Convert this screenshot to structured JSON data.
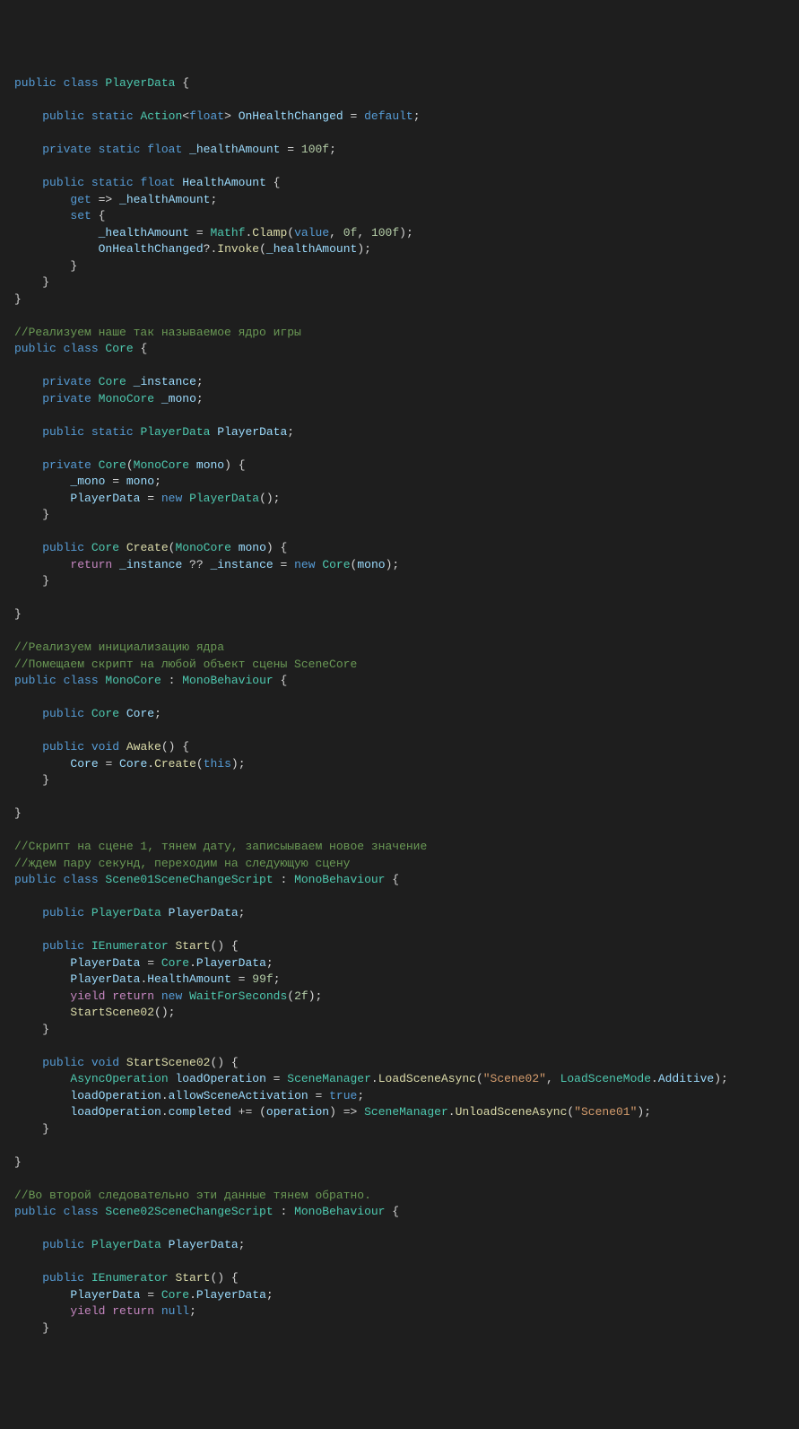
{
  "lines": [
    [
      {
        "t": "public ",
        "c": "kw"
      },
      {
        "t": "class ",
        "c": "kw"
      },
      {
        "t": "PlayerData",
        "c": "type"
      },
      {
        "t": " {",
        "c": "punc"
      }
    ],
    [],
    [
      {
        "t": "    ",
        "c": "punc"
      },
      {
        "t": "public ",
        "c": "kw"
      },
      {
        "t": "static ",
        "c": "kw"
      },
      {
        "t": "Action",
        "c": "type"
      },
      {
        "t": "<",
        "c": "punc"
      },
      {
        "t": "float",
        "c": "kw"
      },
      {
        "t": "> ",
        "c": "punc"
      },
      {
        "t": "OnHealthChanged",
        "c": "var"
      },
      {
        "t": " = ",
        "c": "punc"
      },
      {
        "t": "default",
        "c": "kw"
      },
      {
        "t": ";",
        "c": "punc"
      }
    ],
    [],
    [
      {
        "t": "    ",
        "c": "punc"
      },
      {
        "t": "private ",
        "c": "kw"
      },
      {
        "t": "static ",
        "c": "kw"
      },
      {
        "t": "float ",
        "c": "kw"
      },
      {
        "t": "_healthAmount",
        "c": "var"
      },
      {
        "t": " = ",
        "c": "punc"
      },
      {
        "t": "100f",
        "c": "num"
      },
      {
        "t": ";",
        "c": "punc"
      }
    ],
    [],
    [
      {
        "t": "    ",
        "c": "punc"
      },
      {
        "t": "public ",
        "c": "kw"
      },
      {
        "t": "static ",
        "c": "kw"
      },
      {
        "t": "float ",
        "c": "kw"
      },
      {
        "t": "HealthAmount",
        "c": "var"
      },
      {
        "t": " {",
        "c": "punc"
      }
    ],
    [
      {
        "t": "        ",
        "c": "punc"
      },
      {
        "t": "get",
        "c": "kw"
      },
      {
        "t": " => ",
        "c": "punc"
      },
      {
        "t": "_healthAmount",
        "c": "var"
      },
      {
        "t": ";",
        "c": "punc"
      }
    ],
    [
      {
        "t": "        ",
        "c": "punc"
      },
      {
        "t": "set",
        "c": "kw"
      },
      {
        "t": " {",
        "c": "punc"
      }
    ],
    [
      {
        "t": "            ",
        "c": "punc"
      },
      {
        "t": "_healthAmount",
        "c": "var"
      },
      {
        "t": " = ",
        "c": "punc"
      },
      {
        "t": "Mathf",
        "c": "type"
      },
      {
        "t": ".",
        "c": "punc"
      },
      {
        "t": "Clamp",
        "c": "method"
      },
      {
        "t": "(",
        "c": "punc"
      },
      {
        "t": "value",
        "c": "kw"
      },
      {
        "t": ", ",
        "c": "punc"
      },
      {
        "t": "0f",
        "c": "num"
      },
      {
        "t": ", ",
        "c": "punc"
      },
      {
        "t": "100f",
        "c": "num"
      },
      {
        "t": ");",
        "c": "punc"
      }
    ],
    [
      {
        "t": "            ",
        "c": "punc"
      },
      {
        "t": "OnHealthChanged",
        "c": "var"
      },
      {
        "t": "?.",
        "c": "punc"
      },
      {
        "t": "Invoke",
        "c": "method"
      },
      {
        "t": "(",
        "c": "punc"
      },
      {
        "t": "_healthAmount",
        "c": "var"
      },
      {
        "t": ");",
        "c": "punc"
      }
    ],
    [
      {
        "t": "        }",
        "c": "punc"
      }
    ],
    [
      {
        "t": "    }",
        "c": "punc"
      }
    ],
    [
      {
        "t": "}",
        "c": "punc"
      }
    ],
    [],
    [
      {
        "t": "//Реализуем наше так называемое ядро игры",
        "c": "comment"
      }
    ],
    [
      {
        "t": "public ",
        "c": "kw"
      },
      {
        "t": "class ",
        "c": "kw"
      },
      {
        "t": "Core",
        "c": "type"
      },
      {
        "t": " {",
        "c": "punc"
      }
    ],
    [],
    [
      {
        "t": "    ",
        "c": "punc"
      },
      {
        "t": "private ",
        "c": "kw"
      },
      {
        "t": "Core ",
        "c": "type"
      },
      {
        "t": "_instance",
        "c": "var"
      },
      {
        "t": ";",
        "c": "punc"
      }
    ],
    [
      {
        "t": "    ",
        "c": "punc"
      },
      {
        "t": "private ",
        "c": "kw"
      },
      {
        "t": "MonoCore ",
        "c": "type"
      },
      {
        "t": "_mono",
        "c": "var"
      },
      {
        "t": ";",
        "c": "punc"
      }
    ],
    [],
    [
      {
        "t": "    ",
        "c": "punc"
      },
      {
        "t": "public ",
        "c": "kw"
      },
      {
        "t": "static ",
        "c": "kw"
      },
      {
        "t": "PlayerData ",
        "c": "type"
      },
      {
        "t": "PlayerData",
        "c": "var"
      },
      {
        "t": ";",
        "c": "punc"
      }
    ],
    [],
    [
      {
        "t": "    ",
        "c": "punc"
      },
      {
        "t": "private ",
        "c": "kw"
      },
      {
        "t": "Core",
        "c": "type"
      },
      {
        "t": "(",
        "c": "punc"
      },
      {
        "t": "MonoCore ",
        "c": "type"
      },
      {
        "t": "mono",
        "c": "var"
      },
      {
        "t": ") {",
        "c": "punc"
      }
    ],
    [
      {
        "t": "        ",
        "c": "punc"
      },
      {
        "t": "_mono",
        "c": "var"
      },
      {
        "t": " = ",
        "c": "punc"
      },
      {
        "t": "mono",
        "c": "var"
      },
      {
        "t": ";",
        "c": "punc"
      }
    ],
    [
      {
        "t": "        ",
        "c": "punc"
      },
      {
        "t": "PlayerData",
        "c": "var"
      },
      {
        "t": " = ",
        "c": "punc"
      },
      {
        "t": "new ",
        "c": "kw"
      },
      {
        "t": "PlayerData",
        "c": "type"
      },
      {
        "t": "();",
        "c": "punc"
      }
    ],
    [
      {
        "t": "    }",
        "c": "punc"
      }
    ],
    [],
    [
      {
        "t": "    ",
        "c": "punc"
      },
      {
        "t": "public ",
        "c": "kw"
      },
      {
        "t": "Core ",
        "c": "type"
      },
      {
        "t": "Create",
        "c": "method"
      },
      {
        "t": "(",
        "c": "punc"
      },
      {
        "t": "MonoCore ",
        "c": "type"
      },
      {
        "t": "mono",
        "c": "var"
      },
      {
        "t": ") {",
        "c": "punc"
      }
    ],
    [
      {
        "t": "        ",
        "c": "punc"
      },
      {
        "t": "return ",
        "c": "ctrl"
      },
      {
        "t": "_instance",
        "c": "var"
      },
      {
        "t": " ?? ",
        "c": "punc"
      },
      {
        "t": "_instance",
        "c": "var"
      },
      {
        "t": " = ",
        "c": "punc"
      },
      {
        "t": "new ",
        "c": "kw"
      },
      {
        "t": "Core",
        "c": "type"
      },
      {
        "t": "(",
        "c": "punc"
      },
      {
        "t": "mono",
        "c": "var"
      },
      {
        "t": ");",
        "c": "punc"
      }
    ],
    [
      {
        "t": "    }",
        "c": "punc"
      }
    ],
    [],
    [
      {
        "t": "}",
        "c": "punc"
      }
    ],
    [],
    [
      {
        "t": "//Реализуем инициализацию ядра",
        "c": "comment"
      }
    ],
    [
      {
        "t": "//Помещаем скрипт на любой объект сцены SceneCore",
        "c": "comment"
      }
    ],
    [
      {
        "t": "public ",
        "c": "kw"
      },
      {
        "t": "class ",
        "c": "kw"
      },
      {
        "t": "MonoCore",
        "c": "type"
      },
      {
        "t": " : ",
        "c": "punc"
      },
      {
        "t": "MonoBehaviour",
        "c": "type"
      },
      {
        "t": " {",
        "c": "punc"
      }
    ],
    [],
    [
      {
        "t": "    ",
        "c": "punc"
      },
      {
        "t": "public ",
        "c": "kw"
      },
      {
        "t": "Core ",
        "c": "type"
      },
      {
        "t": "Core",
        "c": "var"
      },
      {
        "t": ";",
        "c": "punc"
      }
    ],
    [],
    [
      {
        "t": "    ",
        "c": "punc"
      },
      {
        "t": "public ",
        "c": "kw"
      },
      {
        "t": "void ",
        "c": "kw"
      },
      {
        "t": "Awake",
        "c": "method"
      },
      {
        "t": "() {",
        "c": "punc"
      }
    ],
    [
      {
        "t": "        ",
        "c": "punc"
      },
      {
        "t": "Core",
        "c": "var"
      },
      {
        "t": " = ",
        "c": "punc"
      },
      {
        "t": "Core",
        "c": "var"
      },
      {
        "t": ".",
        "c": "punc"
      },
      {
        "t": "Create",
        "c": "method"
      },
      {
        "t": "(",
        "c": "punc"
      },
      {
        "t": "this",
        "c": "kw"
      },
      {
        "t": ");",
        "c": "punc"
      }
    ],
    [
      {
        "t": "    }",
        "c": "punc"
      }
    ],
    [],
    [
      {
        "t": "}",
        "c": "punc"
      }
    ],
    [],
    [
      {
        "t": "//Скрипт на сцене 1, тянем дату, записыываем новое значение",
        "c": "comment"
      }
    ],
    [
      {
        "t": "//ждем пару секунд, переходим на следующую сцену",
        "c": "comment"
      }
    ],
    [
      {
        "t": "public ",
        "c": "kw"
      },
      {
        "t": "class ",
        "c": "kw"
      },
      {
        "t": "Scene01SceneChangeScript",
        "c": "type"
      },
      {
        "t": " : ",
        "c": "punc"
      },
      {
        "t": "MonoBehaviour",
        "c": "type"
      },
      {
        "t": " {",
        "c": "punc"
      }
    ],
    [],
    [
      {
        "t": "    ",
        "c": "punc"
      },
      {
        "t": "public ",
        "c": "kw"
      },
      {
        "t": "PlayerData ",
        "c": "type"
      },
      {
        "t": "PlayerData",
        "c": "var"
      },
      {
        "t": ";",
        "c": "punc"
      }
    ],
    [],
    [
      {
        "t": "    ",
        "c": "punc"
      },
      {
        "t": "public ",
        "c": "kw"
      },
      {
        "t": "IEnumerator ",
        "c": "type"
      },
      {
        "t": "Start",
        "c": "method"
      },
      {
        "t": "() {",
        "c": "punc"
      }
    ],
    [
      {
        "t": "        ",
        "c": "punc"
      },
      {
        "t": "PlayerData",
        "c": "var"
      },
      {
        "t": " = ",
        "c": "punc"
      },
      {
        "t": "Core",
        "c": "type"
      },
      {
        "t": ".",
        "c": "punc"
      },
      {
        "t": "PlayerData",
        "c": "var"
      },
      {
        "t": ";",
        "c": "punc"
      }
    ],
    [
      {
        "t": "        ",
        "c": "punc"
      },
      {
        "t": "PlayerData",
        "c": "var"
      },
      {
        "t": ".",
        "c": "punc"
      },
      {
        "t": "HealthAmount",
        "c": "var"
      },
      {
        "t": " = ",
        "c": "punc"
      },
      {
        "t": "99f",
        "c": "num"
      },
      {
        "t": ";",
        "c": "punc"
      }
    ],
    [
      {
        "t": "        ",
        "c": "punc"
      },
      {
        "t": "yield ",
        "c": "ctrl"
      },
      {
        "t": "return ",
        "c": "ctrl"
      },
      {
        "t": "new ",
        "c": "kw"
      },
      {
        "t": "WaitForSeconds",
        "c": "type"
      },
      {
        "t": "(",
        "c": "punc"
      },
      {
        "t": "2f",
        "c": "num"
      },
      {
        "t": ");",
        "c": "punc"
      }
    ],
    [
      {
        "t": "        ",
        "c": "punc"
      },
      {
        "t": "StartScene02",
        "c": "method"
      },
      {
        "t": "();",
        "c": "punc"
      }
    ],
    [
      {
        "t": "    }",
        "c": "punc"
      }
    ],
    [],
    [
      {
        "t": "    ",
        "c": "punc"
      },
      {
        "t": "public ",
        "c": "kw"
      },
      {
        "t": "void ",
        "c": "kw"
      },
      {
        "t": "StartScene02",
        "c": "method"
      },
      {
        "t": "() {",
        "c": "punc"
      }
    ],
    [
      {
        "t": "        ",
        "c": "punc"
      },
      {
        "t": "AsyncOperation ",
        "c": "type"
      },
      {
        "t": "loadOperation",
        "c": "var"
      },
      {
        "t": " = ",
        "c": "punc"
      },
      {
        "t": "SceneManager",
        "c": "type"
      },
      {
        "t": ".",
        "c": "punc"
      },
      {
        "t": "LoadSceneAsync",
        "c": "method"
      },
      {
        "t": "(",
        "c": "punc"
      },
      {
        "t": "\"Scene02\"",
        "c": "str"
      },
      {
        "t": ", ",
        "c": "punc"
      },
      {
        "t": "LoadSceneMode",
        "c": "type"
      },
      {
        "t": ".",
        "c": "punc"
      },
      {
        "t": "Additive",
        "c": "var"
      },
      {
        "t": ");",
        "c": "punc"
      }
    ],
    [
      {
        "t": "        ",
        "c": "punc"
      },
      {
        "t": "loadOperation",
        "c": "var"
      },
      {
        "t": ".",
        "c": "punc"
      },
      {
        "t": "allowSceneActivation",
        "c": "var"
      },
      {
        "t": " = ",
        "c": "punc"
      },
      {
        "t": "true",
        "c": "kw"
      },
      {
        "t": ";",
        "c": "punc"
      }
    ],
    [
      {
        "t": "        ",
        "c": "punc"
      },
      {
        "t": "loadOperation",
        "c": "var"
      },
      {
        "t": ".",
        "c": "punc"
      },
      {
        "t": "completed",
        "c": "var"
      },
      {
        "t": " += (",
        "c": "punc"
      },
      {
        "t": "operation",
        "c": "var"
      },
      {
        "t": ") => ",
        "c": "punc"
      },
      {
        "t": "SceneManager",
        "c": "type"
      },
      {
        "t": ".",
        "c": "punc"
      },
      {
        "t": "UnloadSceneAsync",
        "c": "method"
      },
      {
        "t": "(",
        "c": "punc"
      },
      {
        "t": "\"Scene01\"",
        "c": "str"
      },
      {
        "t": ");",
        "c": "punc"
      }
    ],
    [
      {
        "t": "    }",
        "c": "punc"
      }
    ],
    [],
    [
      {
        "t": "}",
        "c": "punc"
      }
    ],
    [],
    [
      {
        "t": "//Во второй следовательно эти данные тянем обратно.",
        "c": "comment"
      }
    ],
    [
      {
        "t": "public ",
        "c": "kw"
      },
      {
        "t": "class ",
        "c": "kw"
      },
      {
        "t": "Scene02SceneChangeScript",
        "c": "type"
      },
      {
        "t": " : ",
        "c": "punc"
      },
      {
        "t": "MonoBehaviour",
        "c": "type"
      },
      {
        "t": " {",
        "c": "punc"
      }
    ],
    [],
    [
      {
        "t": "    ",
        "c": "punc"
      },
      {
        "t": "public ",
        "c": "kw"
      },
      {
        "t": "PlayerData ",
        "c": "type"
      },
      {
        "t": "PlayerData",
        "c": "var"
      },
      {
        "t": ";",
        "c": "punc"
      }
    ],
    [],
    [
      {
        "t": "    ",
        "c": "punc"
      },
      {
        "t": "public ",
        "c": "kw"
      },
      {
        "t": "IEnumerator ",
        "c": "type"
      },
      {
        "t": "Start",
        "c": "method"
      },
      {
        "t": "() {",
        "c": "punc"
      }
    ],
    [
      {
        "t": "        ",
        "c": "punc"
      },
      {
        "t": "PlayerData",
        "c": "var"
      },
      {
        "t": " = ",
        "c": "punc"
      },
      {
        "t": "Core",
        "c": "type"
      },
      {
        "t": ".",
        "c": "punc"
      },
      {
        "t": "PlayerData",
        "c": "var"
      },
      {
        "t": ";",
        "c": "punc"
      }
    ],
    [
      {
        "t": "        ",
        "c": "punc"
      },
      {
        "t": "yield ",
        "c": "ctrl"
      },
      {
        "t": "return ",
        "c": "ctrl"
      },
      {
        "t": "null",
        "c": "kw"
      },
      {
        "t": ";",
        "c": "punc"
      }
    ],
    [
      {
        "t": "    }",
        "c": "punc"
      }
    ]
  ]
}
